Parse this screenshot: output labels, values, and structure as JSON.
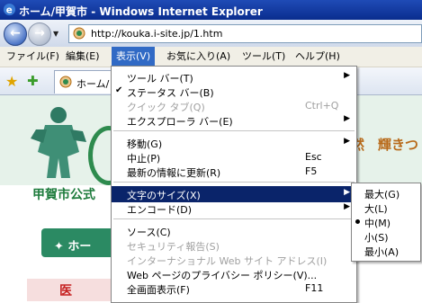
{
  "window": {
    "title": "ホーム/甲賀市 - Windows Internet Explorer"
  },
  "address_bar": {
    "url": "http://kouka.i-site.jp/1.htm"
  },
  "menubar": {
    "items": [
      "ファイル(F)",
      "編集(E)",
      "表示(V)",
      "お気に入り(A)",
      "ツール(T)",
      "ヘルプ(H)"
    ],
    "active": "表示(V)"
  },
  "favorites_bar": {
    "tab_label": "ホーム/"
  },
  "page": {
    "site_name": "甲賀市公式",
    "banner_text": "然　輝きつ",
    "green_button": "✦ ホー",
    "bottom_text": "医"
  },
  "view_menu": {
    "items": [
      {
        "label": "ツール バー(T)",
        "shortcut": "",
        "submenu": true,
        "disabled": false,
        "checked": false
      },
      {
        "label": "ステータス バー(B)",
        "shortcut": "",
        "submenu": false,
        "disabled": false,
        "checked": true
      },
      {
        "label": "クイック タブ(Q)",
        "shortcut": "Ctrl+Q",
        "submenu": false,
        "disabled": true,
        "checked": false
      },
      {
        "label": "エクスプローラ バー(E)",
        "shortcut": "",
        "submenu": true,
        "disabled": false,
        "checked": false
      },
      {
        "label": "移動(G)",
        "shortcut": "",
        "submenu": true,
        "disabled": false,
        "checked": false
      },
      {
        "label": "中止(P)",
        "shortcut": "Esc",
        "submenu": false,
        "disabled": false,
        "checked": false
      },
      {
        "label": "最新の情報に更新(R)",
        "shortcut": "F5",
        "submenu": false,
        "disabled": false,
        "checked": false
      },
      {
        "label": "文字のサイズ(X)",
        "shortcut": "",
        "submenu": true,
        "disabled": false,
        "checked": false,
        "highlighted": true
      },
      {
        "label": "エンコード(D)",
        "shortcut": "",
        "submenu": true,
        "disabled": false,
        "checked": false
      },
      {
        "label": "ソース(C)",
        "shortcut": "",
        "submenu": false,
        "disabled": false,
        "checked": false
      },
      {
        "label": "セキュリティ報告(S)",
        "shortcut": "",
        "submenu": false,
        "disabled": true,
        "checked": false
      },
      {
        "label": "インターナショナル Web サイト アドレス(I)",
        "shortcut": "",
        "submenu": false,
        "disabled": true,
        "checked": false
      },
      {
        "label": "Web ページのプライバシー ポリシー(V)...",
        "shortcut": "",
        "submenu": false,
        "disabled": false,
        "checked": false
      },
      {
        "label": "全画面表示(F)",
        "shortcut": "F11",
        "submenu": false,
        "disabled": false,
        "checked": false
      }
    ]
  },
  "text_size_submenu": {
    "items": [
      "最大(G)",
      "大(L)",
      "中(M)",
      "小(S)",
      "最小(A)"
    ],
    "selected": "中(M)"
  }
}
